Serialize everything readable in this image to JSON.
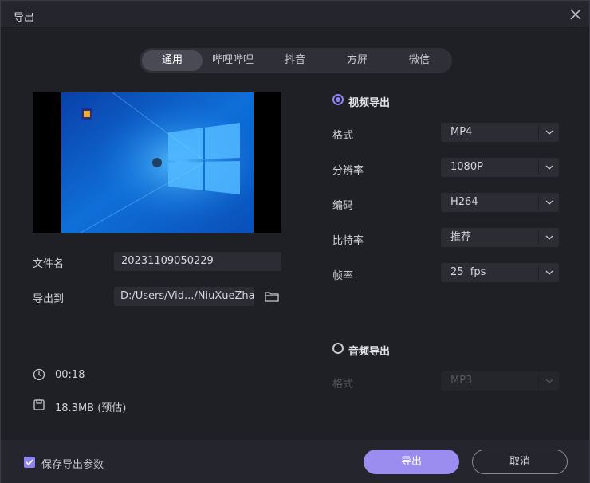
{
  "window": {
    "title": "导出"
  },
  "tabs": [
    {
      "label": "通用",
      "active": true
    },
    {
      "label": "哔哩哔哩",
      "active": false
    },
    {
      "label": "抖音",
      "active": false
    },
    {
      "label": "方屏",
      "active": false
    },
    {
      "label": "微信",
      "active": false
    }
  ],
  "left": {
    "filename_label": "文件名",
    "filename_value": "20231109050229",
    "export_to_label": "导出到",
    "export_path": "D:/Users/Vid.../NiuXueZhang",
    "duration": "00:18",
    "size": "18.3MB (预估)"
  },
  "video_export": {
    "label": "视频导出",
    "checked": true,
    "rows": [
      {
        "label": "格式",
        "value": "MP4"
      },
      {
        "label": "分辨率",
        "value": "1080P"
      },
      {
        "label": "编码",
        "value": "H264"
      },
      {
        "label": "比特率",
        "value": "推荐"
      },
      {
        "label": "帧率",
        "value": "25  fps"
      }
    ]
  },
  "audio_export": {
    "label": "音频导出",
    "checked": false,
    "format_label": "格式",
    "format_value": "MP3"
  },
  "footer": {
    "save_params_label": "保存导出参数",
    "save_params_checked": true,
    "export_button": "导出",
    "cancel_button": "取消"
  },
  "colors": {
    "accent": "#9b8cf0",
    "radio_accent": "#8e84f0",
    "background": "#1f1f26",
    "field": "#2c2c35"
  }
}
